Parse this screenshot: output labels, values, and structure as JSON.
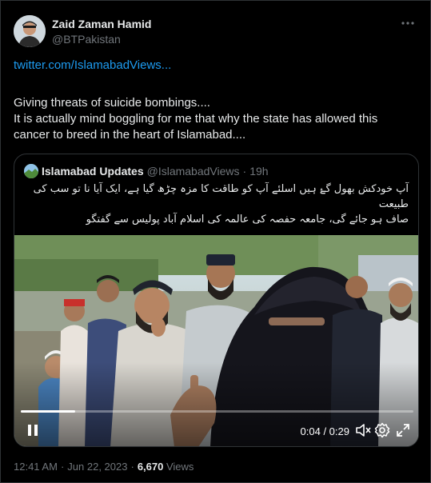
{
  "author": {
    "display_name": "Zaid Zaman Hamid",
    "handle": "@BTPakistan",
    "more_icon": "more-horizontal-icon"
  },
  "tweet": {
    "link_text": "twitter.com/IslamabadViews...",
    "lines": [
      "Giving threats of suicide bombings....",
      "It is actually mind boggling for me that why the state has allowed this",
      "cancer to breed in the heart of Islamabad...."
    ]
  },
  "quoted": {
    "display_name": "Islamabad Updates",
    "handle": "@IslamabadViews",
    "dot": "·",
    "time": "19h",
    "text_lines": [
      "آپ خودکش بھول گۓ ہیں اسلئے آپ کو طاقت کا مزہ چڑھ گیا ہے، ایک آیا نا تو سب کی طبیعت",
      "صاف ہو جائے گی، جامعہ حفصہ کی عالمہ کی اسلام آباد پولیس سے گفتگو"
    ],
    "video": {
      "time_readout": "0:04 / 0:29",
      "progress": 0.138,
      "controls": [
        "pause-icon",
        "volume-muted-icon",
        "settings-gear-icon",
        "fullscreen-icon"
      ]
    }
  },
  "meta": {
    "time": "12:41 AM",
    "dot": "·",
    "date": "Jun 22, 2023",
    "dot2": "·",
    "views_count": "6,670",
    "views_label": "Views"
  },
  "colors": {
    "background": "#000000",
    "text": "#e7e9ea",
    "secondary": "#71767b",
    "link": "#1d9bf0",
    "border": "#2f3336"
  }
}
